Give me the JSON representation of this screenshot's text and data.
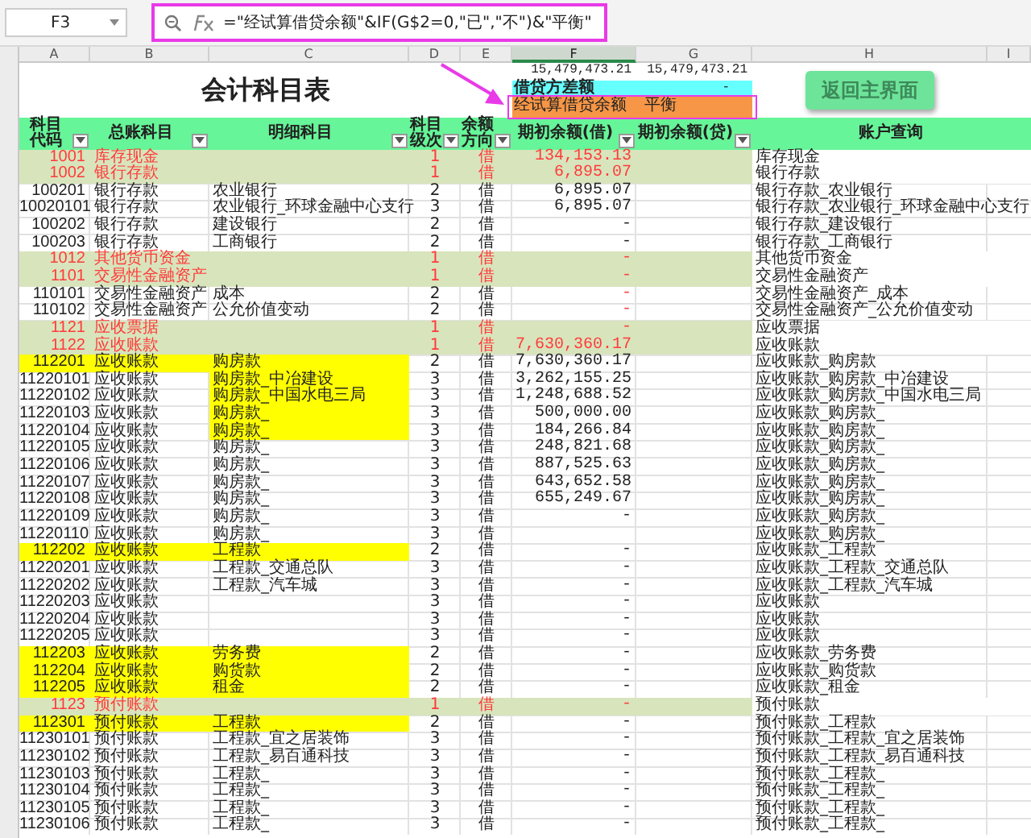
{
  "formula_bar": {
    "cell_ref": "F3",
    "formula": "=\"经试算借贷余额\"&IF(G$2=0,\"已\",\"不\")&\"平衡\""
  },
  "column_headers": [
    {
      "label": "A",
      "selected": false
    },
    {
      "label": "B",
      "selected": false
    },
    {
      "label": "C",
      "selected": false
    },
    {
      "label": "D",
      "selected": false
    },
    {
      "label": "E",
      "selected": false
    },
    {
      "label": "F",
      "selected": true
    },
    {
      "label": "G",
      "selected": false
    },
    {
      "label": "H",
      "selected": false
    },
    {
      "label": "I",
      "selected": false
    }
  ],
  "title": "会计科目表",
  "summary": {
    "debit_total": "15,479,473.21",
    "credit_total": "15,479,473.21",
    "difference_label": "借贷方差额",
    "difference": "-",
    "check_label": "经试算借贷余额",
    "check_result": "平衡"
  },
  "return_button": "返回主界面",
  "table": {
    "columns": [
      {
        "label": "科目代码",
        "filter": true
      },
      {
        "label": "总账科目",
        "filter": true
      },
      {
        "label": "明细科目",
        "filter": true
      },
      {
        "label": "科目级次",
        "filter": true
      },
      {
        "label": "余额方向",
        "filter": true
      },
      {
        "label": "期初余额(借)",
        "filter": true
      },
      {
        "label": "期初余额(贷)",
        "filter": true
      },
      {
        "label": "账户查询",
        "filter": false
      }
    ],
    "rows": [
      {
        "kind": "summary",
        "code": "1001",
        "account": "库存现金",
        "level": "1",
        "direction": "借",
        "debit": "134,153.13",
        "query": "库存现金"
      },
      {
        "kind": "summary",
        "code": "1002",
        "account": "银行存款",
        "level": "1",
        "direction": "借",
        "debit": "6,895.07",
        "query": "银行存款"
      },
      {
        "kind": "normal",
        "code": "100201",
        "account": "银行存款",
        "detail": "农业银行",
        "level": "2",
        "direction": "借",
        "debit": "6,895.07",
        "query": "银行存款_农业银行"
      },
      {
        "kind": "normal",
        "code": "10020101",
        "account": "银行存款",
        "detail": "农业银行_环球金融中心支行",
        "level": "3",
        "direction": "借",
        "debit": "6,895.07",
        "query": "银行存款_农业银行_环球金融中心支行"
      },
      {
        "kind": "normal",
        "code": "100202",
        "account": "银行存款",
        "detail": "建设银行",
        "level": "2",
        "direction": "借",
        "debit": "-",
        "query": "银行存款_建设银行"
      },
      {
        "kind": "normal",
        "code": "100203",
        "account": "银行存款",
        "detail": "工商银行",
        "level": "2",
        "direction": "借",
        "debit": "-",
        "query": "银行存款_工商银行"
      },
      {
        "kind": "summary",
        "code": "1012",
        "account": "其他货币资金",
        "level": "1",
        "direction": "借",
        "debit": "-",
        "query": "其他货币资金"
      },
      {
        "kind": "summary",
        "code": "1101",
        "account": "交易性金融资产",
        "level": "1",
        "direction": "借",
        "debit": "-",
        "query": "交易性金融资产"
      },
      {
        "kind": "normal",
        "code": "110101",
        "account": "交易性金融资产",
        "detail": "成本",
        "level": "2",
        "direction": "借",
        "debit": "-",
        "debit_alert": true,
        "query": "交易性金融资产_成本"
      },
      {
        "kind": "normal",
        "code": "110102",
        "account": "交易性金融资产",
        "detail": "公允价值变动",
        "level": "2",
        "direction": "借",
        "debit": "-",
        "debit_alert": true,
        "query": "交易性金融资产_公允价值变动"
      },
      {
        "kind": "summary",
        "code": "1121",
        "account": "应收票据",
        "level": "1",
        "direction": "借",
        "debit": "-",
        "query": "应收票据"
      },
      {
        "kind": "summary",
        "code": "1122",
        "account": "应收账款",
        "level": "1",
        "direction": "借",
        "debit": "7,630,360.17",
        "query": "应收账款"
      },
      {
        "kind": "highlight",
        "code": "112201",
        "account": "应收账款",
        "detail": "购房款",
        "level": "2",
        "direction": "借",
        "debit": "7,630,360.17",
        "query": "应收账款_购房款"
      },
      {
        "kind": "detail-highlight",
        "code": "11220101",
        "account": "应收账款",
        "detail": "购房款_中冶建设",
        "level": "3",
        "direction": "借",
        "debit": "3,262,155.25",
        "query": "应收账款_购房款_中冶建设"
      },
      {
        "kind": "detail-highlight",
        "code": "11220102",
        "account": "应收账款",
        "detail": "购房款_中国水电三局",
        "level": "3",
        "direction": "借",
        "debit": "1,248,688.52",
        "query": "应收账款_购房款_中国水电三局"
      },
      {
        "kind": "detail-highlight",
        "code": "11220103",
        "account": "应收账款",
        "detail": "购房款_",
        "level": "3",
        "direction": "借",
        "debit": "500,000.00",
        "query": "应收账款_购房款_"
      },
      {
        "kind": "detail-highlight",
        "code": "11220104",
        "account": "应收账款",
        "detail": "购房款_",
        "level": "3",
        "direction": "借",
        "debit": "184,266.84",
        "query": "应收账款_购房款_"
      },
      {
        "kind": "normal",
        "code": "11220105",
        "account": "应收账款",
        "detail": "购房款_",
        "level": "3",
        "direction": "借",
        "debit": "248,821.68",
        "query": "应收账款_购房款_"
      },
      {
        "kind": "normal",
        "code": "11220106",
        "account": "应收账款",
        "detail": "购房款_",
        "level": "3",
        "direction": "借",
        "debit": "887,525.63",
        "query": "应收账款_购房款_"
      },
      {
        "kind": "normal",
        "code": "11220107",
        "account": "应收账款",
        "detail": "购房款_",
        "level": "3",
        "direction": "借",
        "debit": "643,652.58",
        "query": "应收账款_购房款_"
      },
      {
        "kind": "normal",
        "code": "11220108",
        "account": "应收账款",
        "detail": "购房款_",
        "level": "3",
        "direction": "借",
        "debit": "655,249.67",
        "query": "应收账款_购房款_"
      },
      {
        "kind": "normal",
        "code": "11220109",
        "account": "应收账款",
        "detail": "购房款_",
        "level": "3",
        "direction": "借",
        "debit": "-",
        "query": "应收账款_购房款_"
      },
      {
        "kind": "normal",
        "code": "11220110",
        "account": "应收账款",
        "detail": "购房款_",
        "level": "3",
        "direction": "借",
        "query": "应收账款_购房款_"
      },
      {
        "kind": "highlight",
        "code": "112202",
        "account": "应收账款",
        "detail": "工程款",
        "level": "2",
        "direction": "借",
        "debit": "-",
        "query": "应收账款_工程款"
      },
      {
        "kind": "normal",
        "code": "11220201",
        "account": "应收账款",
        "detail": "工程款_交通总队",
        "level": "3",
        "direction": "借",
        "debit": "-",
        "query": "应收账款_工程款_交通总队"
      },
      {
        "kind": "normal",
        "code": "11220202",
        "account": "应收账款",
        "detail": "工程款_汽车城",
        "level": "3",
        "direction": "借",
        "debit": "-",
        "query": "应收账款_工程款_汽车城"
      },
      {
        "kind": "normal",
        "code": "11220203",
        "account": "应收账款",
        "level": "3",
        "direction": "借",
        "debit": "-",
        "query": "应收账款"
      },
      {
        "kind": "normal",
        "code": "11220204",
        "account": "应收账款",
        "level": "3",
        "direction": "借",
        "debit": "-",
        "query": "应收账款"
      },
      {
        "kind": "normal",
        "code": "11220205",
        "account": "应收账款",
        "level": "3",
        "direction": "借",
        "debit": "-",
        "query": "应收账款"
      },
      {
        "kind": "highlight",
        "code": "112203",
        "account": "应收账款",
        "detail": "劳务费",
        "level": "2",
        "direction": "借",
        "debit": "-",
        "query": "应收账款_劳务费"
      },
      {
        "kind": "highlight",
        "code": "112204",
        "account": "应收账款",
        "detail": "购货款",
        "level": "2",
        "direction": "借",
        "debit": "-",
        "query": "应收账款_购货款"
      },
      {
        "kind": "highlight",
        "code": "112205",
        "account": "应收账款",
        "detail": "租金",
        "level": "2",
        "direction": "借",
        "debit": "-",
        "query": "应收账款_租金"
      },
      {
        "kind": "summary",
        "code": "1123",
        "account": "预付账款",
        "level": "1",
        "direction": "借",
        "debit": "-",
        "query": "预付账款"
      },
      {
        "kind": "highlight",
        "code": "112301",
        "account": "预付账款",
        "detail": "工程款",
        "level": "2",
        "direction": "借",
        "debit": "-",
        "query": "预付账款_工程款"
      },
      {
        "kind": "normal",
        "code": "11230101",
        "account": "预付账款",
        "detail": "工程款_宜之居装饰",
        "level": "3",
        "direction": "借",
        "debit": "-",
        "query": "预付账款_工程款_宜之居装饰"
      },
      {
        "kind": "normal",
        "code": "11230102",
        "account": "预付账款",
        "detail": "工程款_易百通科技",
        "level": "3",
        "direction": "借",
        "debit": "-",
        "query": "预付账款_工程款_易百通科技"
      },
      {
        "kind": "normal",
        "code": "11230103",
        "account": "预付账款",
        "detail": "工程款_",
        "level": "3",
        "direction": "借",
        "debit": "-",
        "query": "预付账款_工程款_"
      },
      {
        "kind": "normal",
        "code": "11230104",
        "account": "预付账款",
        "detail": "工程款_",
        "level": "3",
        "direction": "借",
        "debit": "-",
        "query": "预付账款_工程款_"
      },
      {
        "kind": "normal",
        "code": "11230105",
        "account": "预付账款",
        "detail": "工程款_",
        "level": "3",
        "direction": "借",
        "debit": "-",
        "query": "预付账款_工程款_"
      },
      {
        "kind": "normal",
        "code": "11230106",
        "account": "预付账款",
        "detail": "工程款_",
        "level": "3",
        "direction": "借",
        "debit": "-",
        "query": "预付账款_工程款_"
      }
    ]
  }
}
